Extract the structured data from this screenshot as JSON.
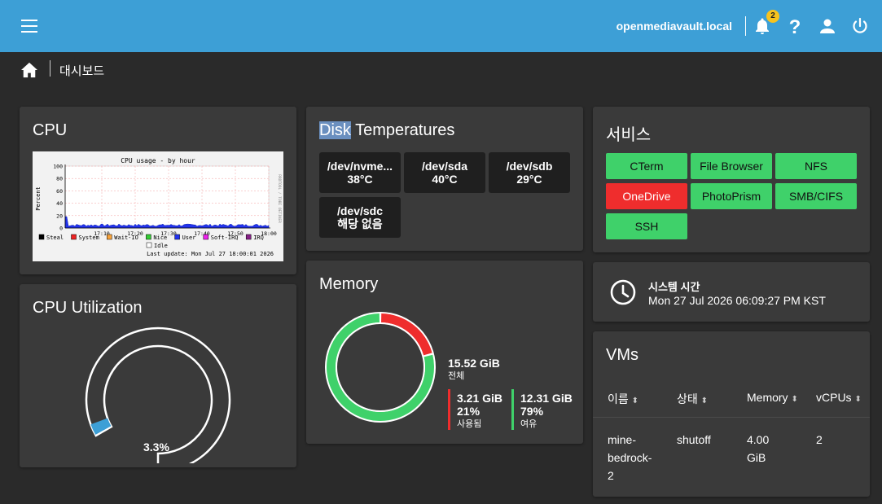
{
  "topbar": {
    "hostname": "openmediavault.local",
    "notifications": "2",
    "bg": "#3d9fd6"
  },
  "breadcrumb": {
    "page": "대시보드"
  },
  "cpu": {
    "title": "CPU",
    "graph_title": "CPU usage - by hour",
    "ylabel": "Percent",
    "side_label": "RRDTOOL / TOBI OETIKER",
    "y_ticks": [
      "100",
      "80",
      "60",
      "40",
      "20",
      "0"
    ],
    "x_ticks": [
      "17:10",
      "17:20",
      "17:30",
      "17:40",
      "17:50",
      "18:00"
    ],
    "legend": [
      {
        "label": "Steal",
        "color": "#000000"
      },
      {
        "label": "System",
        "color": "#ee2222"
      },
      {
        "label": "Wait-IO",
        "color": "#f7a23a"
      },
      {
        "label": "Nice",
        "color": "#33cc33"
      },
      {
        "label": "User",
        "color": "#2233ee"
      },
      {
        "label": "Soft-IRQ",
        "color": "#ee22ee"
      },
      {
        "label": "IRQ",
        "color": "#882288"
      }
    ],
    "idle_label": "Idle",
    "last_update": "Last update: Mon Jul 27 18:00:01 2026"
  },
  "cpu_util": {
    "title": "CPU Utilization",
    "value_text": "3.3%",
    "value": 3.3
  },
  "disk": {
    "title_highlight": "Disk",
    "title_rest": " Temperatures",
    "items": [
      {
        "name": "/dev/nvme...",
        "temp": "38°C"
      },
      {
        "name": "/dev/sda",
        "temp": "40°C"
      },
      {
        "name": "/dev/sdb",
        "temp": "29°C"
      },
      {
        "name": "/dev/sdc",
        "temp": "해당 없음"
      }
    ]
  },
  "memory": {
    "title": "Memory",
    "total": "15.52 GiB",
    "total_label": "전체",
    "used": "3.21 GiB",
    "used_pct": "21%",
    "used_label": "사용됨",
    "free": "12.31 GiB",
    "free_pct": "79%",
    "free_label": "여유",
    "used_fraction": 0.21,
    "used_color": "#ef2d2d",
    "free_color": "#3fd16a"
  },
  "services": {
    "title": "서비스",
    "items": [
      {
        "label": "CTerm",
        "status": "ok"
      },
      {
        "label": "File Browser",
        "status": "ok"
      },
      {
        "label": "NFS",
        "status": "ok"
      },
      {
        "label": "OneDrive",
        "status": "bad"
      },
      {
        "label": "PhotoPrism",
        "status": "ok"
      },
      {
        "label": "SMB/CIFS",
        "status": "ok"
      },
      {
        "label": "SSH",
        "status": "ok"
      }
    ]
  },
  "systime": {
    "label": "시스템 시간",
    "value": "Mon 27 Jul 2026 06:09:27 PM KST"
  },
  "vms": {
    "title": "VMs",
    "columns": [
      "이름",
      "상태",
      "Memory",
      "vCPUs"
    ],
    "rows": [
      {
        "name_lines": [
          "mine-",
          "bedrock-",
          "2"
        ],
        "state": "shutoff",
        "mem_lines": [
          "4.00",
          "GiB"
        ],
        "vcpus": "2"
      }
    ]
  }
}
